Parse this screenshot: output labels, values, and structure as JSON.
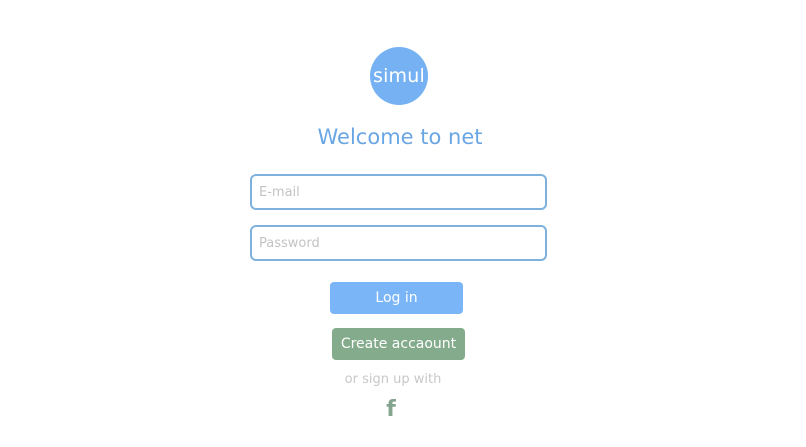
{
  "logo": {
    "text": "simul"
  },
  "title": "Welcome to net",
  "form": {
    "email_placeholder": "E-mail",
    "password_placeholder": "Password",
    "login_label": "Log in",
    "create_label": "Create accaount",
    "signup_text": "or sign up with",
    "facebook_glyph": "f"
  },
  "colors": {
    "accent": "#76b2f3",
    "create_button": "#83ab8c",
    "facebook_icon": "#84a48d"
  }
}
